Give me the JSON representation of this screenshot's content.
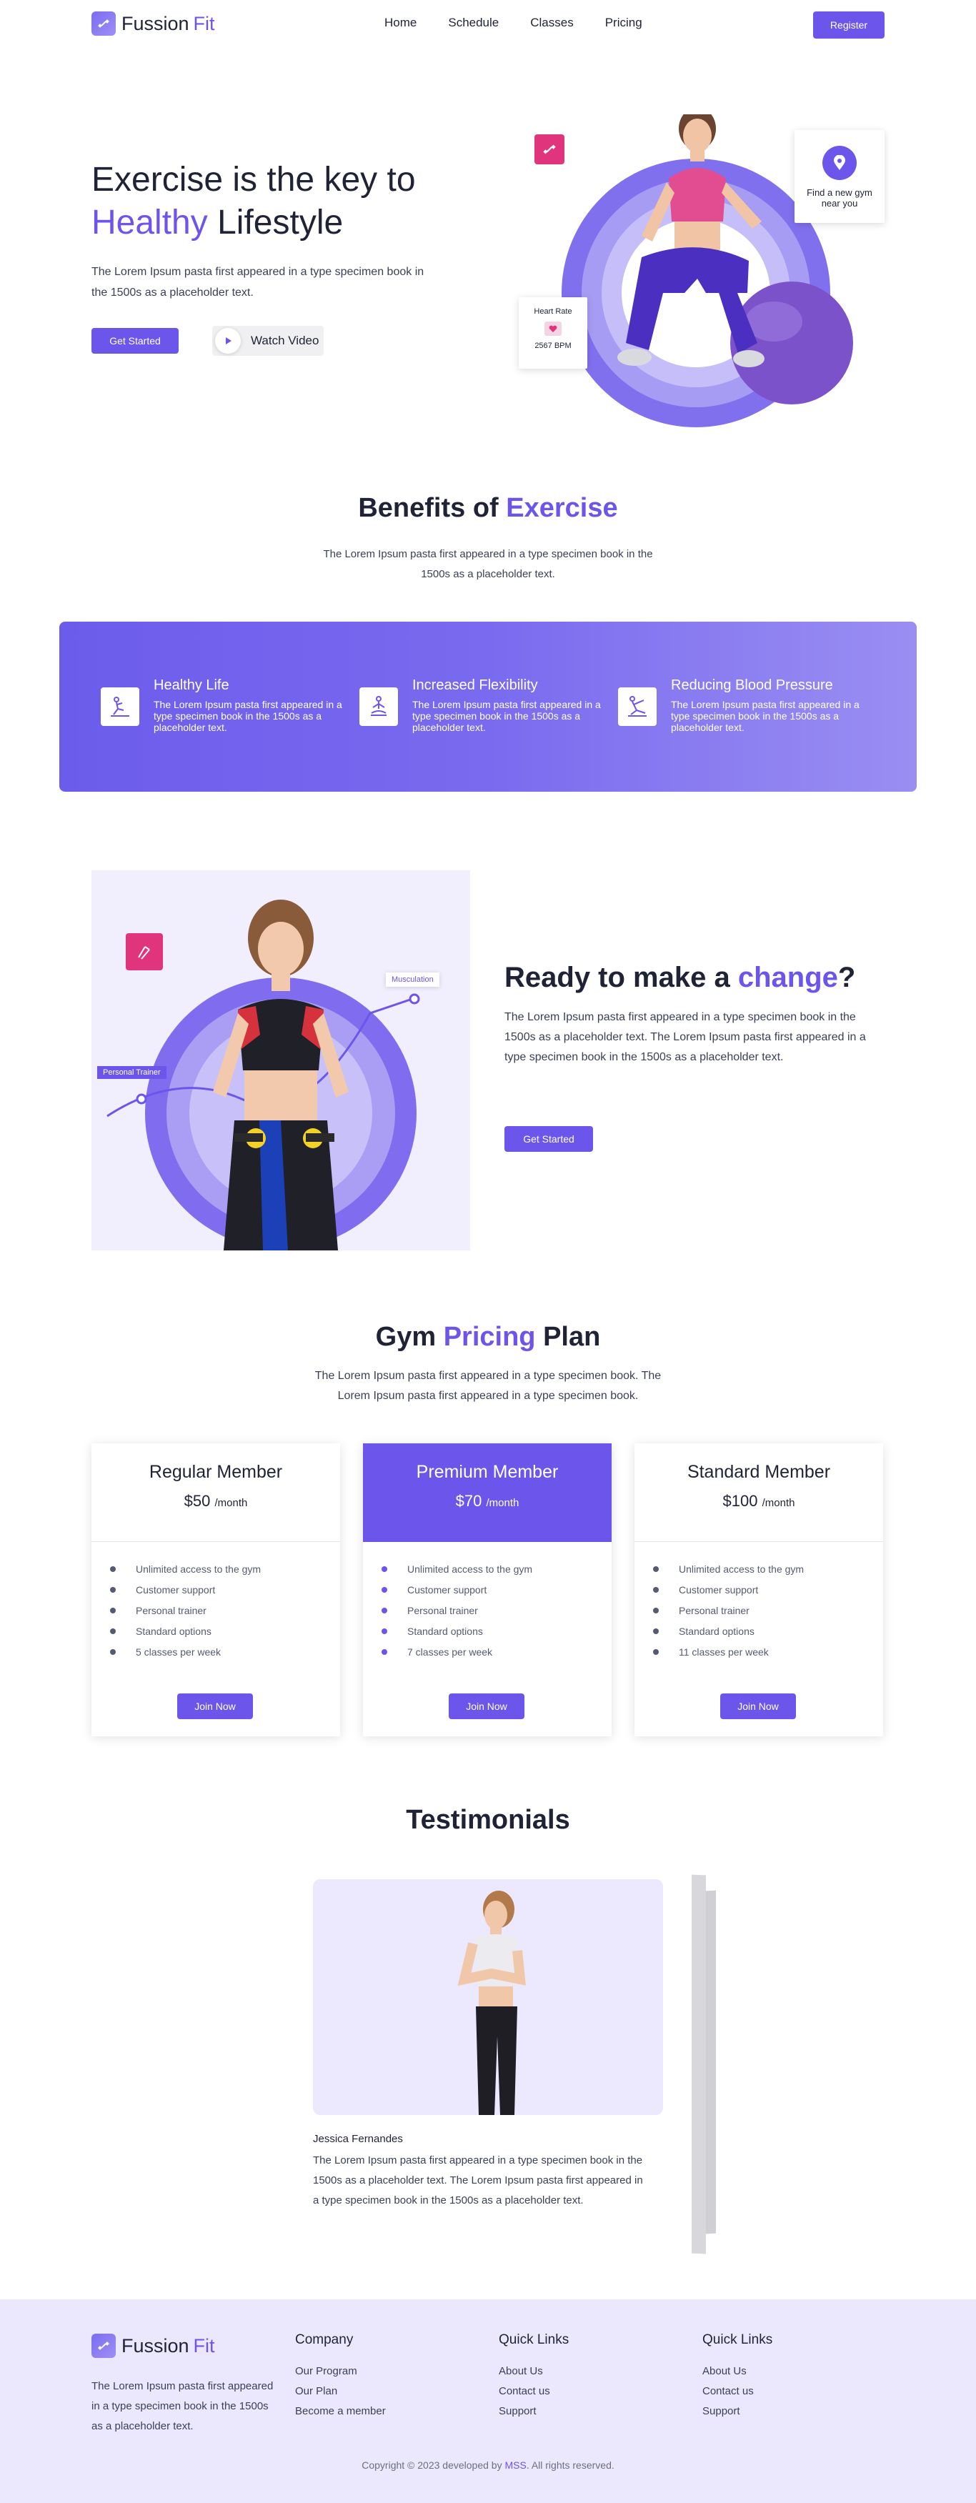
{
  "nav": {
    "logo_main": "Fussion",
    "logo_accent": "Fit",
    "links": [
      "Home",
      "Schedule",
      "Classes",
      "Pricing"
    ],
    "register_label": "Register"
  },
  "hero": {
    "title_line1": "Exercise is the key to",
    "title_accent": "Healthy",
    "title_rest": " Lifestyle",
    "text": "The Lorem Ipsum pasta first appeared in a type specimen book in the 1500s as a placeholder text.",
    "cta_label": "Get Started",
    "watch_label": "Watch Video",
    "heart_rate_label": "Heart Rate",
    "heart_rate_value": "2567 BPM",
    "gym_finder_label": "Find a new gym near you"
  },
  "benefits": {
    "title_main": "Benefits of ",
    "title_accent": "Exercise",
    "text": "The Lorem Ipsum pasta first appeared in a type specimen book in the 1500s as a placeholder text.",
    "items": [
      {
        "title": "Healthy Life",
        "text": "The Lorem Ipsum pasta first appeared in a type specimen book in the 1500s as a placeholder text.",
        "icon": "exercise-icon"
      },
      {
        "title": "Increased Flexibility",
        "text": "The Lorem Ipsum pasta first appeared in a type specimen book in the 1500s as a placeholder text.",
        "icon": "meditation-icon"
      },
      {
        "title": "Reducing Blood Pressure",
        "text": "The Lorem Ipsum pasta first appeared in a type specimen book in the 1500s as a placeholder text.",
        "icon": "stretching-icon"
      }
    ]
  },
  "change": {
    "title_main": "Ready to make a ",
    "title_accent": "change",
    "title_end": "?",
    "text": "The Lorem Ipsum pasta first appeared in a type specimen book in the 1500s as a placeholder text. The Lorem Ipsum pasta first appeared in a type specimen book in the 1500s as a placeholder text.",
    "cta_label": "Get Started",
    "tag_trainer": "Personal Trainer",
    "tag_muscle": "Musculation"
  },
  "pricing": {
    "title_main": "Gym ",
    "title_accent": "Pricing",
    "title_end": " Plan",
    "text": "The Lorem Ipsum pasta first appeared in a type specimen book. The Lorem Ipsum pasta first appeared in a type specimen book.",
    "plans": [
      {
        "name": "Regular Member",
        "price": "$50",
        "period": "/month",
        "features": [
          "Unlimited access to the gym",
          "Customer support",
          "Personal trainer",
          "Standard options",
          "5 classes per week"
        ],
        "cta": "Join Now"
      },
      {
        "name": "Premium Member",
        "price": "$70",
        "period": "/month",
        "features": [
          "Unlimited access to the gym",
          "Customer support",
          "Personal trainer",
          "Standard options",
          "7 classes per week"
        ],
        "cta": "Join Now"
      },
      {
        "name": "Standard Member",
        "price": "$100",
        "period": "/month",
        "features": [
          "Unlimited access to the gym",
          "Customer support",
          "Personal trainer",
          "Standard options",
          "11 classes per week"
        ],
        "cta": "Join Now"
      }
    ]
  },
  "testimonials": {
    "title": "Testimonials",
    "name": "Jessica Fernandes",
    "text": "The Lorem Ipsum pasta first appeared in a type specimen book in the 1500s as a placeholder text. The Lorem Ipsum pasta first appeared in a type specimen book in the 1500s as a placeholder text."
  },
  "footer": {
    "about": "The Lorem Ipsum pasta first appeared in a type specimen book in the 1500s as a placeholder text.",
    "columns": [
      {
        "title": "Company",
        "links": [
          "Our Program",
          "Our Plan",
          "Become a member"
        ]
      },
      {
        "title": "Quick Links",
        "links": [
          "About Us",
          "Contact us",
          "Support"
        ]
      },
      {
        "title": "Quick Links",
        "links": [
          "About Us",
          "Contact us",
          "Support"
        ]
      }
    ],
    "copyright_pre": "Copyright © 2023 developed by ",
    "copyright_brand": "MSS",
    "copyright_post": ". All rights reserved."
  },
  "colors": {
    "accent": "#6c55ea",
    "pink": "#e0357c",
    "footer_bg": "#ebe8fd"
  }
}
